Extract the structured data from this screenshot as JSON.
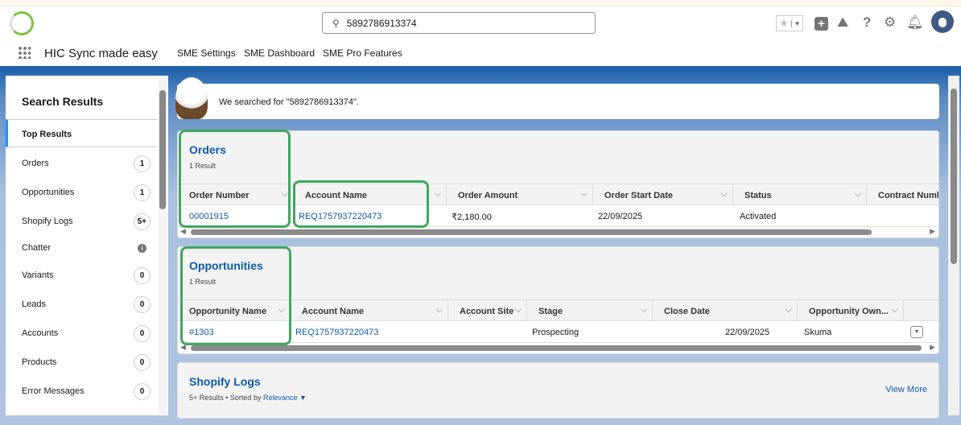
{
  "header": {
    "search_value": "5892786913374",
    "app_name": "HIC Sync made easy",
    "nav": [
      "SME Settings",
      "SME Dashboard",
      "SME Pro Features"
    ],
    "logo_text": "Sync made easy"
  },
  "banner": {
    "text": "We searched for \"5892786913374\"."
  },
  "sidebar": {
    "title": "Search Results",
    "selected": "Top Results",
    "items": [
      {
        "label": "Orders",
        "count": "1"
      },
      {
        "label": "Opportunities",
        "count": "1"
      },
      {
        "label": "Shopify Logs",
        "count": "5+"
      },
      {
        "label": "Chatter",
        "count": "i"
      },
      {
        "label": "Variants",
        "count": "0"
      },
      {
        "label": "Leads",
        "count": "0"
      },
      {
        "label": "Accounts",
        "count": "0"
      },
      {
        "label": "Products",
        "count": "0"
      },
      {
        "label": "Error Messages",
        "count": "0"
      }
    ]
  },
  "orders": {
    "title": "Orders",
    "result_count": "1 Result",
    "columns": [
      "Order Number",
      "Account Name",
      "Order Amount",
      "Order Start Date",
      "Status",
      "Contract Number"
    ],
    "rows": [
      [
        "00001915",
        "REQ1757937220473",
        "₹2,180.00",
        "22/09/2025",
        "Activated",
        ""
      ]
    ]
  },
  "opportunities": {
    "title": "Opportunities",
    "result_count": "1 Result",
    "columns": [
      "Opportunity Name",
      "Account Name",
      "Account Site",
      "Stage",
      "Close Date",
      "Opportunity Own..."
    ],
    "rows": [
      [
        "#1303",
        "REQ1757937220473",
        "",
        "Prospecting",
        "22/09/2025",
        "Skuma"
      ]
    ]
  },
  "shopify_logs": {
    "title": "Shopify Logs",
    "result_info": "5+ Results • Sorted by",
    "sort_field": "Relevance",
    "view_more": "View More"
  }
}
